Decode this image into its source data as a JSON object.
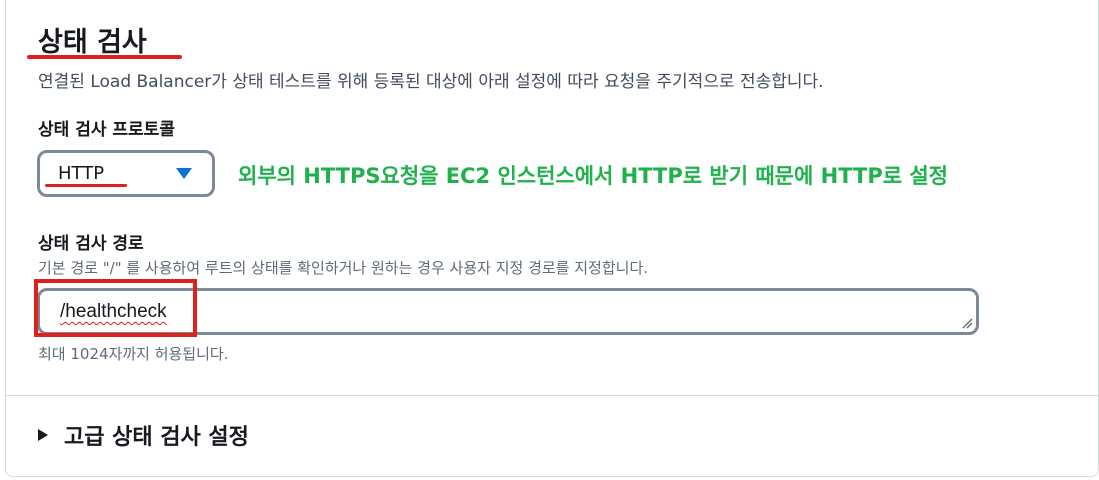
{
  "health_check": {
    "title": "상태 검사",
    "description": "연결된 Load Balancer가 상태 테스트를 위해 등록된 대상에 아래 설정에 따라 요청을 주기적으로 전송합니다.",
    "protocol": {
      "label": "상태 검사 프로토콜",
      "selected": "HTTP"
    },
    "annotation": "외부의 HTTPS요청을 EC2 인스턴스에서 HTTP로 받기 때문에 HTTP로 설정",
    "path": {
      "label": "상태 검사 경로",
      "hint": "기본 경로 \"/\" 를 사용하여 루트의 상태를 확인하거나 원하는 경우 사용자 지정 경로를 지정합니다.",
      "value": "/healthcheck",
      "constraint": "최대 1024자까지 허용됩니다."
    },
    "advanced": {
      "label": "고급 상태 검사 설정"
    }
  },
  "colors": {
    "accent": "#0972d3",
    "annotation": "#1fb24c",
    "highlight": "#e0201a"
  },
  "icons": {
    "select_caret": "caret-down-icon",
    "expander_caret": "caret-right-icon"
  }
}
